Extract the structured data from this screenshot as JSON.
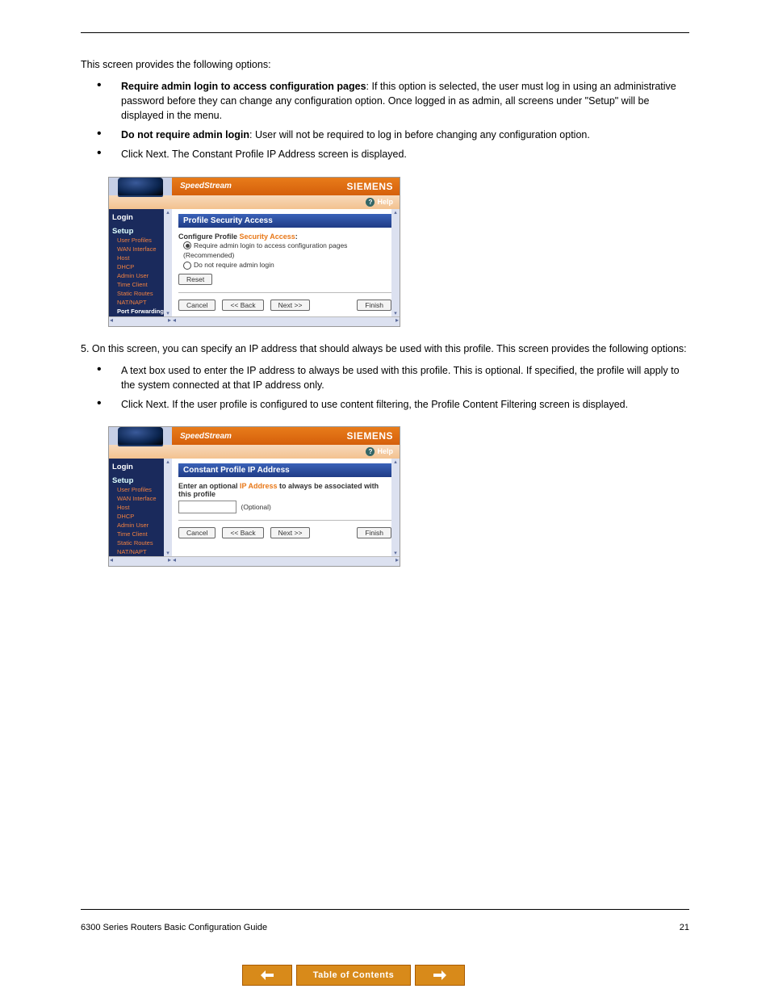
{
  "lead_text": "This screen provides the following options:",
  "bullet1_bold": "Require admin login to access configuration pages",
  "bullet1_rest": ": If this option is selected, the user must log in using an administrative password before they can change any configuration option. Once logged in as admin, all screens under \"Setup\" will be displayed in the menu.",
  "bullet2_bold": "Do not require admin login",
  "bullet2_rest": ": User will not be required to log in before changing any configuration option.",
  "bullet3": "Click Next. The Constant Profile IP Address screen is displayed.",
  "text5": "5. On this screen, you can specify an IP address that should always be used with this profile. This screen provides the following options:",
  "bullet5a": "A text box used to enter the IP address to always be used with this profile. This is optional. If specified, the profile will apply to the system connected at that IP address only.",
  "bullet5b": "Click Next. If the user profile is configured to use content filtering, the Profile Content Filtering screen is displayed.",
  "shot1": {
    "brand": "SpeedStream",
    "vendor": "SIEMENS",
    "help": "Help",
    "nav_login": "Login",
    "nav_setup": "Setup",
    "nav_items": [
      "User Profiles",
      "WAN Interface",
      "Host",
      "DHCP",
      "Admin User",
      "Time Client",
      "Static Routes",
      "NAT/NAPT",
      "Port Forwarding"
    ],
    "panel_title": "Profile Security Access",
    "panel_label_a": "Configure Profile ",
    "panel_label_b": "Security Access",
    "panel_label_c": ":",
    "radio1": "Require admin login to access configuration pages",
    "radio1_note": "(Recommended)",
    "radio2": "Do not require admin login",
    "btn_reset": "Reset",
    "btn_cancel": "Cancel",
    "btn_back": "<< Back",
    "btn_next": "  Next >>  ",
    "btn_finish": "Finish"
  },
  "shot2": {
    "brand": "SpeedStream",
    "vendor": "SIEMENS",
    "help": "Help",
    "nav_login": "Login",
    "nav_setup": "Setup",
    "nav_items": [
      "User Profiles",
      "WAN Interface",
      "Host",
      "DHCP",
      "Admin User",
      "Time Client",
      "Static Routes",
      "NAT/NAPT"
    ],
    "panel_title": "Constant Profile IP Address",
    "prompt_a": "Enter an optional ",
    "prompt_b": "IP Address",
    "prompt_c": " to always be associated with this profile",
    "optional": "(Optional)",
    "btn_cancel": "Cancel",
    "btn_back": "<< Back",
    "btn_next": "  Next >>  ",
    "btn_finish": "Finish"
  },
  "footer_left": "6300 Series Routers Basic Configuration Guide",
  "footer_right": "21",
  "toc": {
    "label": "Table of Contents"
  }
}
